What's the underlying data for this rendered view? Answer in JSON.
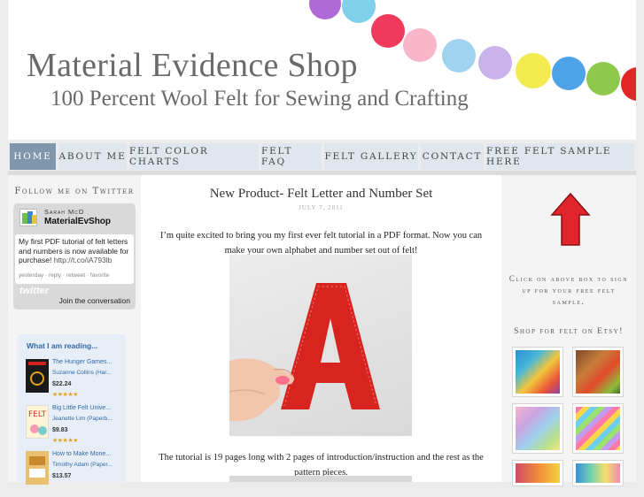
{
  "header": {
    "title": "Material Evidence Shop",
    "subtitle": "100 Percent Wool Felt for Sewing and Crafting"
  },
  "nav": {
    "items": [
      "Home",
      "About Me",
      "Felt Color Charts",
      "Felt FAQ",
      "Felt Gallery",
      "Contact",
      "Free Felt Sample Here"
    ],
    "active": "Home"
  },
  "left": {
    "follow_heading": "Follow me on Twitter",
    "twitter": {
      "name": "Sarah McD",
      "handle": "MaterialEvShop",
      "tweet": "My first PDF tutorial of felt letters and numbers is now available for purchase!",
      "tweet_link": "http://t.co/iA793lb",
      "meta": "yesterday · reply · retweet · favorite",
      "logo": "twitter",
      "join": "Join the conversation"
    },
    "reading": {
      "title": "What I am reading...",
      "books": [
        {
          "title": "The Hunger Games...",
          "author": "Suzanne Collins (Har...",
          "price": "$22.24",
          "stars": "★★★★★"
        },
        {
          "title": "Big Little Felt Unive...",
          "author": "Jeanette Lim (Paperb...",
          "price": "$9.83",
          "stars": "★★★★★"
        },
        {
          "title": "How to Make Mone...",
          "author": "Timothy Adam (Paper...",
          "price": "$13.57",
          "stars": "★★★★★"
        }
      ]
    }
  },
  "post": {
    "title": "New Product- Felt Letter and Number Set",
    "date": "JULY 7, 2011",
    "intro": "I’m quite excited to bring you my first ever felt tutorial in a PDF format. Now you can make your own alphabet and number set out of felt!",
    "photo_letter": "A",
    "body": "The tutorial is 19 pages long with 2 pages of introduction/instruction and the rest as the pattern pieces."
  },
  "right": {
    "caption": "Click on above box to sign up for your free felt sample.",
    "shop_heading": "Shop for felt on Etsy!"
  },
  "colors": {
    "nav_bg": "#dfe6ee",
    "nav_active": "#7f96ad",
    "arrow": "#e0262b",
    "felt_red": "#d8241f"
  }
}
